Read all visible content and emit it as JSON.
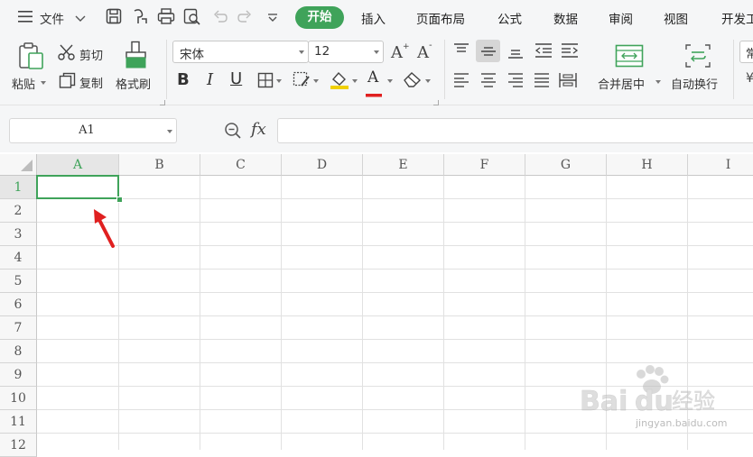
{
  "menubar": {
    "file_label": "文件",
    "tabs": [
      "开始",
      "插入",
      "页面布局",
      "公式",
      "数据",
      "审阅",
      "视图",
      "开发工"
    ]
  },
  "ribbon": {
    "paste_label": "粘贴",
    "cut_label": "剪切",
    "copy_label": "复制",
    "format_painter_label": "格式刷",
    "font_name": "宋体",
    "font_size": "12",
    "bold_label": "B",
    "italic_label": "I",
    "underline_label": "U",
    "font_color_label": "A",
    "merge_center_label": "合并居中",
    "wrap_text_label": "自动换行",
    "number_format_label": "常",
    "partial_label": "¥"
  },
  "formula_bar": {
    "cell_reference": "A1",
    "fx_label": "fx",
    "formula_value": ""
  },
  "sheet": {
    "columns": [
      "A",
      "B",
      "C",
      "D",
      "E",
      "F",
      "G",
      "H",
      "I"
    ],
    "rows": [
      "1",
      "2",
      "3",
      "4",
      "5",
      "6",
      "7",
      "8",
      "9",
      "10",
      "11",
      "12"
    ],
    "selected_cell": "A1"
  },
  "colors": {
    "accent_green": "#3fa35a",
    "annotation_red": "#e02020"
  },
  "watermark": {
    "brand": "Baidu 经验",
    "url": "jingyan.baidu.com"
  }
}
